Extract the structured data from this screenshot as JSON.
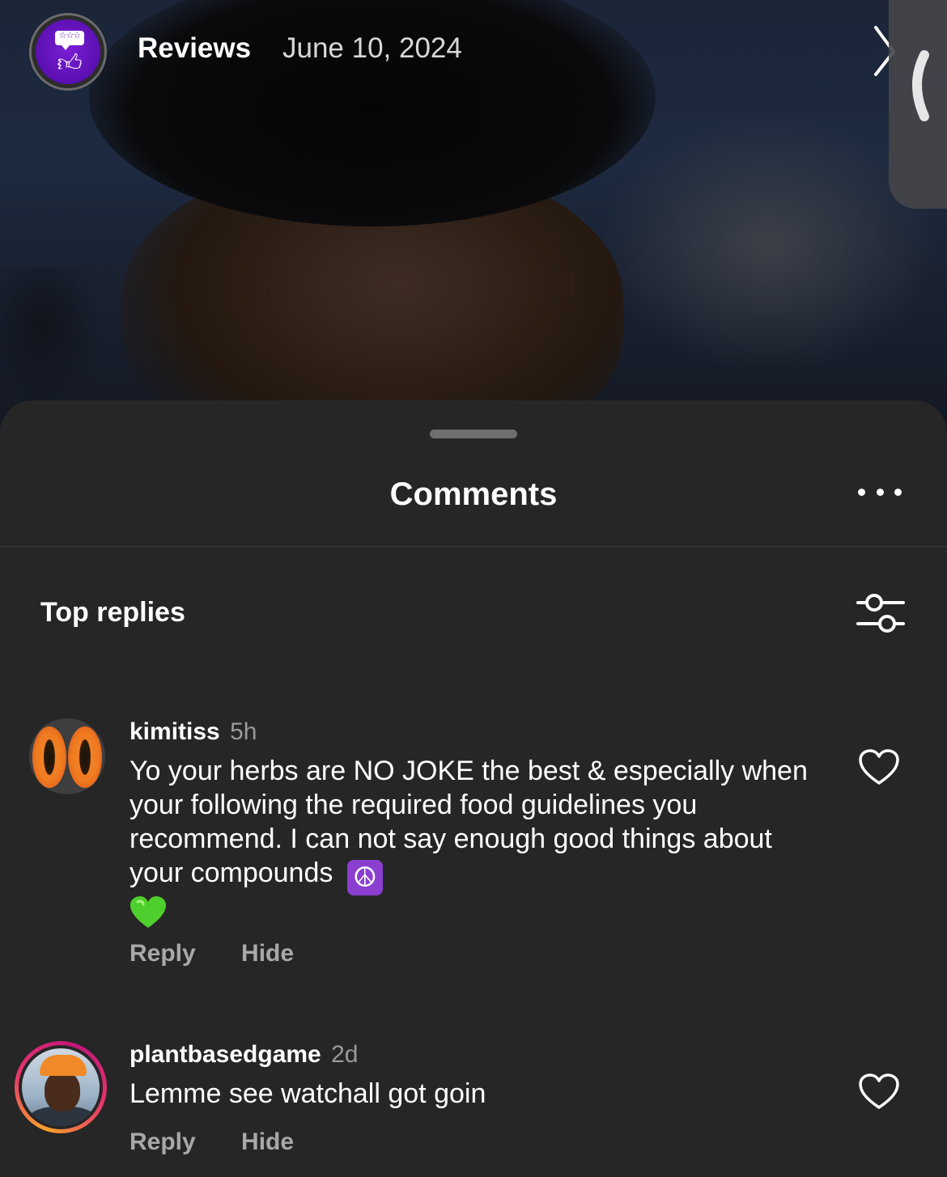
{
  "story": {
    "account_name": "Reviews",
    "date": "June 10, 2024"
  },
  "sheet": {
    "title": "Comments",
    "section_title": "Top replies"
  },
  "comments": [
    {
      "username": "kimitiss",
      "time": "5h",
      "text": "Yo your herbs are NO JOKE  the best & especially when your following the required food guidelines you recommend. I can not say enough good things about your compounds",
      "emojis": [
        "☮",
        "💚"
      ],
      "reply_label": "Reply",
      "hide_label": "Hide"
    },
    {
      "username": "plantbasedgame",
      "time": "2d",
      "text": "Lemme see watchall got goin",
      "reply_label": "Reply",
      "hide_label": "Hide"
    }
  ],
  "icons": {
    "story_avatar": "thumbs-up-review-icon",
    "next": "chevron-right-icon",
    "side_tab": "chevron-left-icon",
    "more": "more-dots-icon",
    "filter": "sliders-filter-icon",
    "like": "heart-outline-icon"
  },
  "colors": {
    "sheet_bg": "#262626",
    "text_primary": "#ffffff",
    "text_secondary": "#a8a8a8",
    "brand_purple": "#5a0fb0"
  }
}
